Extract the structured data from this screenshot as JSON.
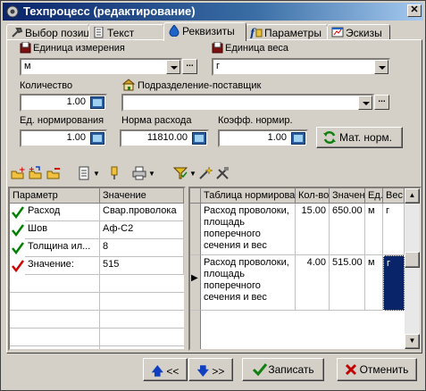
{
  "window": {
    "title": "Техпроцесс (редактирование)"
  },
  "tabs": [
    {
      "label": "Выбор позиции"
    },
    {
      "label": "Текст"
    },
    {
      "label": "Реквизиты"
    },
    {
      "label": "Параметры"
    },
    {
      "label": "Эскизы"
    }
  ],
  "form": {
    "unit_label": "Единица измерения",
    "unit_value": "м",
    "weight_unit_label": "Единица веса",
    "weight_unit_value": "г",
    "quantity_label": "Количество",
    "quantity_value": "1.00",
    "supplier_label": "Подразделение-поставщик",
    "supplier_value": "",
    "norm_unit_label": "Ед. нормирования",
    "norm_unit_value": "1.00",
    "consumption_label": "Норма расхода",
    "consumption_value": "11810.00",
    "coef_label": "Коэфф. нормир.",
    "coef_value": "1.00",
    "mat_norm_button": "Мат. норм."
  },
  "params_table": {
    "headers": [
      "Параметр",
      "Значение"
    ],
    "rows": [
      {
        "name": "Расход",
        "value": "Свар.проволока",
        "check_color": "#008000"
      },
      {
        "name": "Шов",
        "value": "Аф-С2",
        "check_color": "#008000"
      },
      {
        "name": "Толщина ил...",
        "value": "8",
        "check_color": "#008000"
      },
      {
        "name": "Значение:",
        "value": "515",
        "check_color": "#d00000"
      }
    ]
  },
  "norm_table": {
    "headers": [
      "Таблица нормирова",
      "Кол-во",
      "Значен",
      "Ед.",
      "Вес"
    ],
    "rows": [
      {
        "table": "Расход проволоки, площадь поперечного сечения и вес",
        "qty": "15.00",
        "value": "650.00",
        "unit": "м",
        "weight": "г"
      },
      {
        "table": "Расход проволоки, площадь поперечного сечения и вес",
        "qty": "4.00",
        "value": "515.00",
        "unit": "м",
        "weight": "г"
      }
    ]
  },
  "footer": {
    "prev_label": "<<",
    "next_label": ">>",
    "save_label": "Записать",
    "cancel_label": "Отменить"
  },
  "colors": {
    "title_bar": "#0a246a",
    "selection": "#0a246a",
    "check_ok": "#008000",
    "check_warn": "#d00000"
  }
}
